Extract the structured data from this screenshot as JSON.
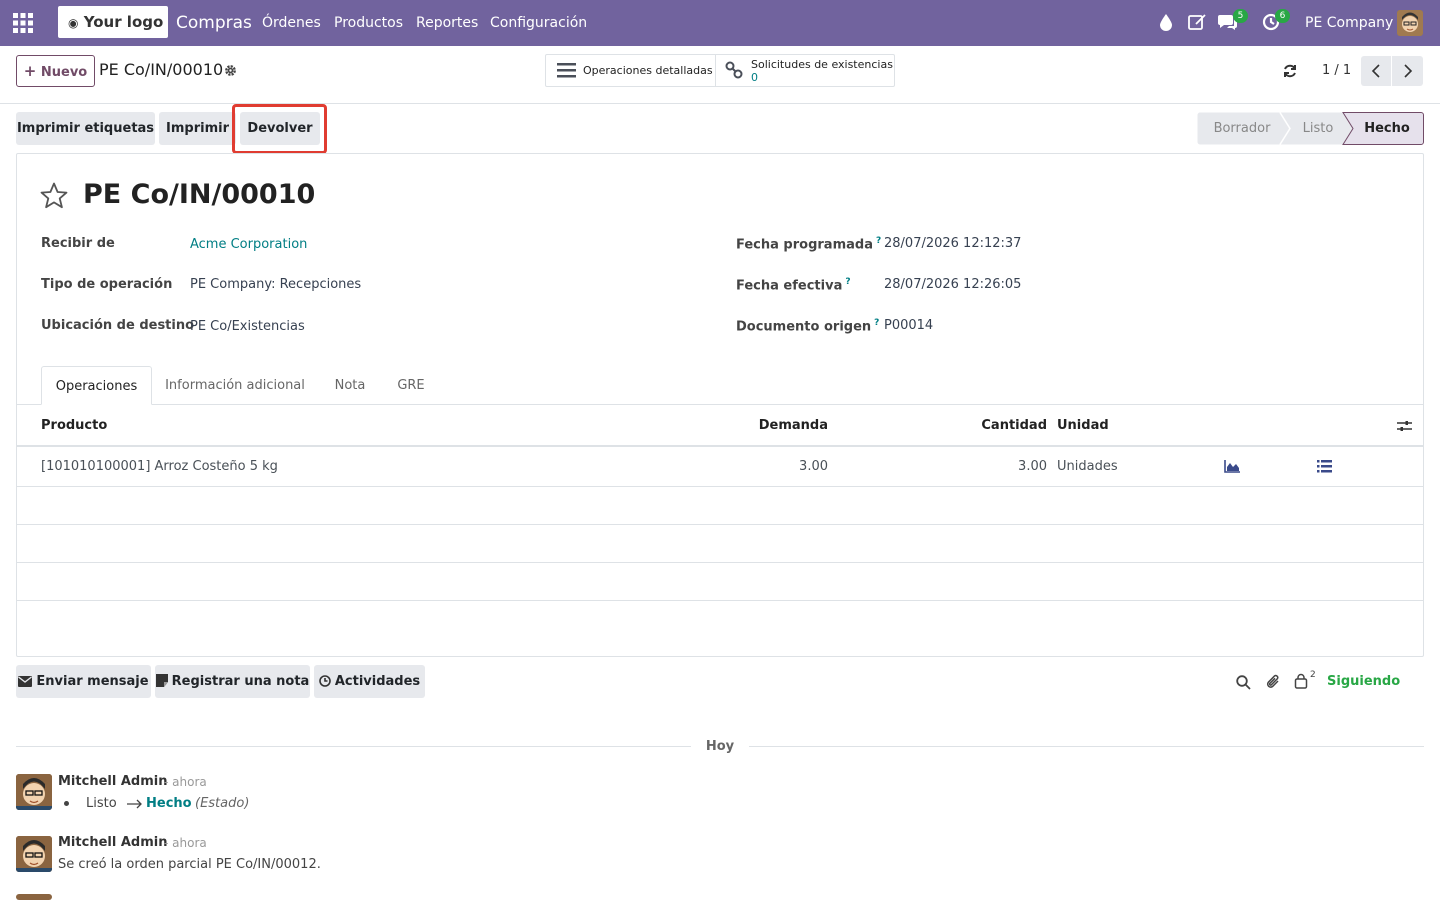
{
  "navbar": {
    "logo": "Your logo",
    "app_name": "Compras",
    "menu": [
      "Órdenes",
      "Productos",
      "Reportes",
      "Configuración"
    ],
    "messages_count": "5",
    "activities_count": "6",
    "company": "PE Company"
  },
  "control": {
    "new_label": "Nuevo",
    "breadcrumb": "PE Co/IN/00010",
    "smart_ops_label": "Operaciones detalladas",
    "smart_stock_label": "Solicitudes de existencias",
    "smart_stock_value": "0",
    "pager": "1 / 1"
  },
  "actions": {
    "print_labels": "Imprimir etiquetas",
    "print": "Imprimir",
    "return": "Devolver"
  },
  "statusbar": [
    "Borrador",
    "Listo",
    "Hecho"
  ],
  "record": {
    "title": "PE Co/IN/00010",
    "fields_left": [
      {
        "label": "Recibir de",
        "value": "Acme Corporation"
      },
      {
        "label": "Tipo de operación",
        "value": "PE Company: Recepciones"
      },
      {
        "label": "Ubicación de destino",
        "value": "PE Co/Existencias"
      }
    ],
    "fields_right": [
      {
        "label": "Fecha programada",
        "value": "28/07/2026 12:12:37"
      },
      {
        "label": "Fecha efectiva",
        "value": "28/07/2026 12:26:05"
      },
      {
        "label": "Documento origen",
        "value": "P00014"
      }
    ],
    "help_mark": "?"
  },
  "tabs": [
    "Operaciones",
    "Información adicional",
    "Nota",
    "GRE"
  ],
  "table": {
    "headers": {
      "product": "Producto",
      "demand": "Demanda",
      "quantity": "Cantidad",
      "unit": "Unidad"
    },
    "rows": [
      {
        "product": "[101010100001] Arroz Costeño 5 kg",
        "demand": "3.00",
        "quantity": "3.00",
        "unit": "Unidades"
      }
    ]
  },
  "chatter": {
    "send_message": "Enviar mensaje",
    "log_note": "Registrar una nota",
    "activities": "Actividades",
    "followers_count": "2",
    "following": "Siguiendo",
    "date_separator": "Hoy",
    "messages": [
      {
        "author": "Mitchell Admin",
        "time": "- ahora",
        "from": "Listo",
        "to": "Hecho",
        "field": "(Estado)"
      },
      {
        "author": "Mitchell Admin",
        "time": "- ahora",
        "body": "Se creó la orden parcial PE Co/IN/00012."
      }
    ]
  },
  "colors": {
    "navbar": "#71639e",
    "primary": "#714b67",
    "link": "#017e84",
    "highlight": "#e03c31",
    "success": "#28a745"
  }
}
